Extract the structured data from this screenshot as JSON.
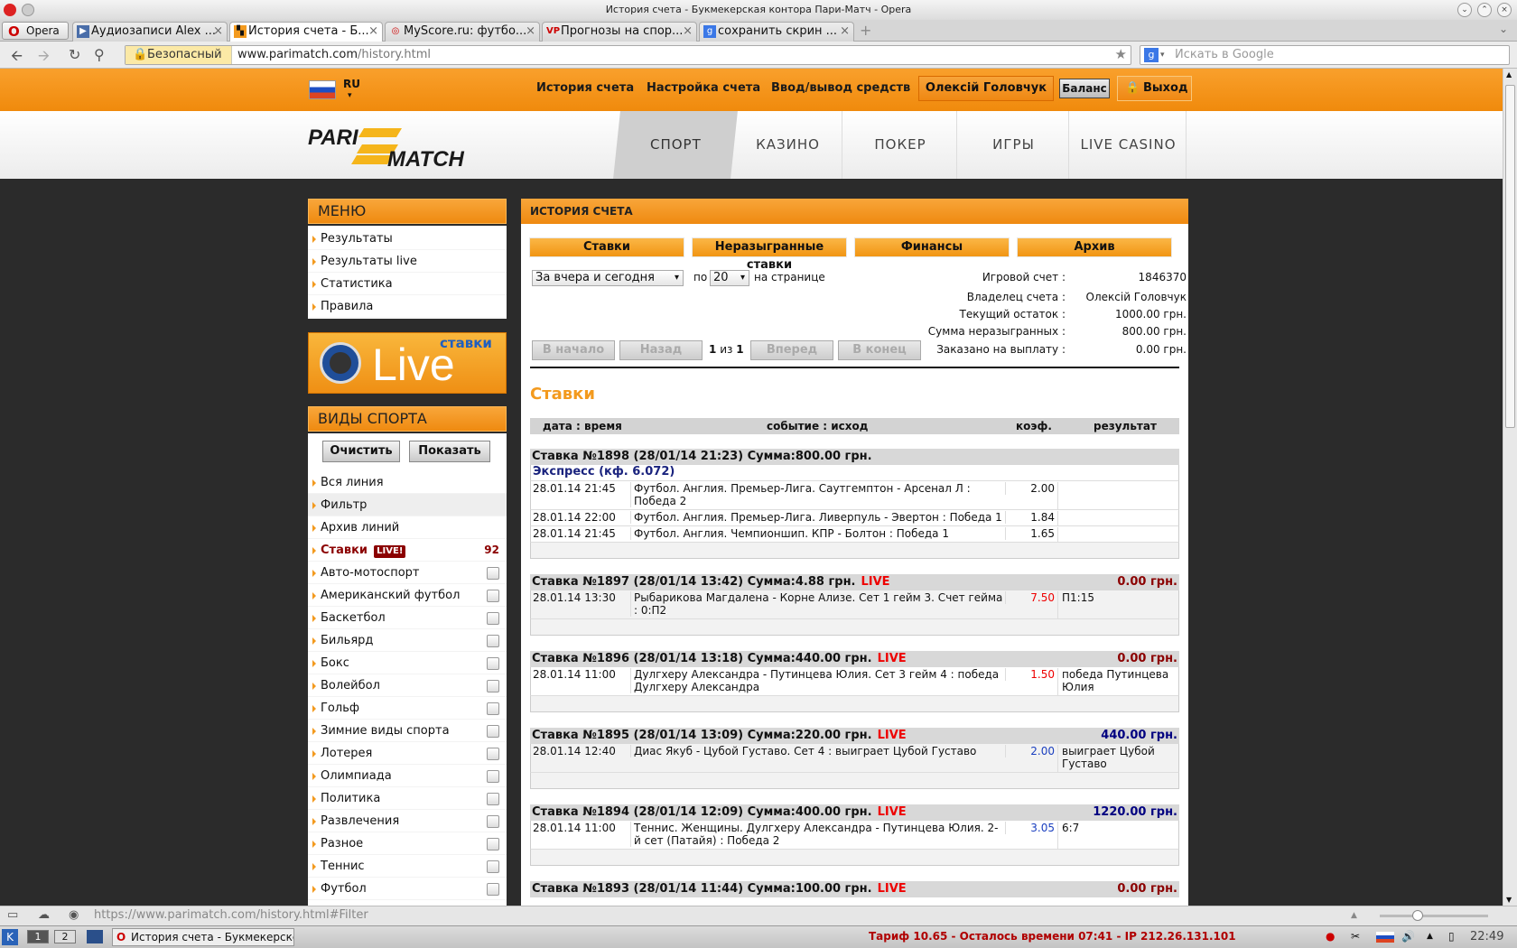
{
  "window": {
    "title": "История счета - Букмекерская контора Пари-Матч - Opera"
  },
  "browser": {
    "menu_label": "Opera",
    "tabs": [
      {
        "label": "Аудиозаписи Alex ..."
      },
      {
        "label": "История счета - Б..."
      },
      {
        "label": "MyScore.ru: футбо..."
      },
      {
        "label": "Прогнозы на спор..."
      },
      {
        "label": "сохранить скрин ..."
      }
    ],
    "secure_label": "Безопасный",
    "url_host": "www.parimatch.com",
    "url_path": "/history.html",
    "search_placeholder": "Искать в Google"
  },
  "topnav": {
    "lang": "RU",
    "links": [
      "История счета",
      "Настройка счета",
      "Ввод/вывод средств"
    ],
    "user": "Олексій Головчук",
    "balance": "Баланс",
    "exit": "Выход"
  },
  "header": {
    "logo_top": "PARI",
    "logo_bottom": "MATCH",
    "tabs": [
      "СПОРТ",
      "КАЗИНО",
      "ПОКЕР",
      "ИГРЫ",
      "LIVE CASINO"
    ]
  },
  "menu": {
    "title": "МЕНЮ",
    "items": [
      "Результаты",
      "Результаты live",
      "Статистика",
      "Правила"
    ]
  },
  "live_banner": {
    "small": "ставки",
    "big": "Live"
  },
  "sports": {
    "title": "ВИДЫ СПОРТА",
    "clear": "Очистить",
    "show": "Показать",
    "top_items": [
      "Вся линия",
      "Фильтр",
      "Архив линий"
    ],
    "bets_label": "Ставки",
    "live_badge": "LIVE!",
    "bets_count": "92",
    "items": [
      "Авто-мотоспорт",
      "Американский футбол",
      "Баскетбол",
      "Бильярд",
      "Бокс",
      "Волейбол",
      "Гольф",
      "Зимние виды спорта",
      "Лотерея",
      "Олимпиада",
      "Политика",
      "Развлечения",
      "Разное",
      "Теннис",
      "Футбол"
    ]
  },
  "history": {
    "title": "ИСТОРИЯ СЧЕТА",
    "buttons": [
      "Ставки",
      "Неразыгранные ставки",
      "Финансы",
      "Архив"
    ],
    "period": "За вчера и сегодня",
    "per_label": "по",
    "per_value": "20",
    "per_suffix": "на странице",
    "nav": {
      "first": "В начало",
      "prev": "Назад",
      "next": "Вперед",
      "last": "В конец",
      "page": "1",
      "of": "из",
      "total": "1"
    },
    "info": [
      {
        "label": "Игровой счет :",
        "value": "1846370"
      },
      {
        "label": "Владелец счета :",
        "value": "Олексій Головчук"
      },
      {
        "label": "Текущий остаток :",
        "value": "1000.00 грн."
      },
      {
        "label": "Сумма неразыгранных :",
        "value": "800.00 грн."
      },
      {
        "label": "Заказано на выплату :",
        "value": "0.00 грн."
      }
    ],
    "section_title": "Ставки",
    "columns": [
      "дата : время",
      "событие : исход",
      "коэф.",
      "результат"
    ],
    "express_label": "Экспресс (кф. 6.072)",
    "live_word": "LIVE",
    "bets": [
      {
        "title": "Ставка №1898  (28/01/14 21:23) Сумма:800.00 грн.",
        "result": "",
        "rows": [
          {
            "dt": "28.01.14 21:45",
            "event": "Футбол. Англия. Премьер-Лига. Саутгемптон - Арсенал Л : Победа 2",
            "coef": "2.00",
            "res": ""
          },
          {
            "dt": "28.01.14 22:00",
            "event": "Футбол. Англия. Премьер-Лига. Ливерпуль - Эвертон : Победа 1",
            "coef": "1.84",
            "res": ""
          },
          {
            "dt": "28.01.14 21:45",
            "event": "Футбол. Англия. Чемпионшип. КПР - Болтон : Победа 1",
            "coef": "1.65",
            "res": ""
          }
        ]
      },
      {
        "title": "Ставка №1897  (28/01/14 13:42) Сумма:4.88 грн.",
        "result": "0.00 грн.",
        "rows": [
          {
            "dt": "28.01.14 13:30",
            "event": "Рыбарикова Магдалена - Корне Ализе. Сет 1 гейм 3. Счет гейма : 0:П2",
            "coef": "7.50",
            "res": "П1:15"
          }
        ]
      },
      {
        "title": "Ставка №1896  (28/01/14 13:18) Сумма:440.00 грн.",
        "result": "0.00 грн.",
        "rows": [
          {
            "dt": "28.01.14 11:00",
            "event": "Дулгхеру Александра - Путинцева Юлия. Сет 3 гейм 4 : победа Дулгхеру Александра",
            "coef": "1.50",
            "res": "победа Путинцева Юлия"
          }
        ]
      },
      {
        "title": "Ставка №1895  (28/01/14 13:09) Сумма:220.00 грн.",
        "result": "440.00 грн.",
        "rows": [
          {
            "dt": "28.01.14 12:40",
            "event": "Диас Якуб - Цубой Густаво. Сет 4 : выиграет Цубой Густаво",
            "coef": "2.00",
            "res": "выиграет Цубой Густаво"
          }
        ]
      },
      {
        "title": "Ставка №1894  (28/01/14 12:09) Сумма:400.00 грн.",
        "result": "1220.00 грн.",
        "rows": [
          {
            "dt": "28.01.14 11:00",
            "event": "Теннис. Женщины. Дулгхеру Александра - Путинцева Юлия. 2-й сет (Патайя) : Победа 2",
            "coef": "3.05",
            "res": "6:7"
          }
        ]
      },
      {
        "title": "Ставка №1893  (28/01/14 11:44) Сумма:100.00 грн.",
        "result": "0.00 грн.",
        "rows": []
      }
    ]
  },
  "status": {
    "url": "https://www.parimatch.com/history.html#Filter"
  },
  "taskbar": {
    "desk1": "1",
    "desk2": "2",
    "task": "История счета - Букмекерске",
    "tariff": "Тариф 10.65 - Осталось времени 07:41 - IP 212.26.131.101",
    "clock": "22:49"
  },
  "colors": {
    "accent": "#f39a1e",
    "win": "#000080",
    "loss": "#8b0000",
    "live": "#e00000"
  }
}
